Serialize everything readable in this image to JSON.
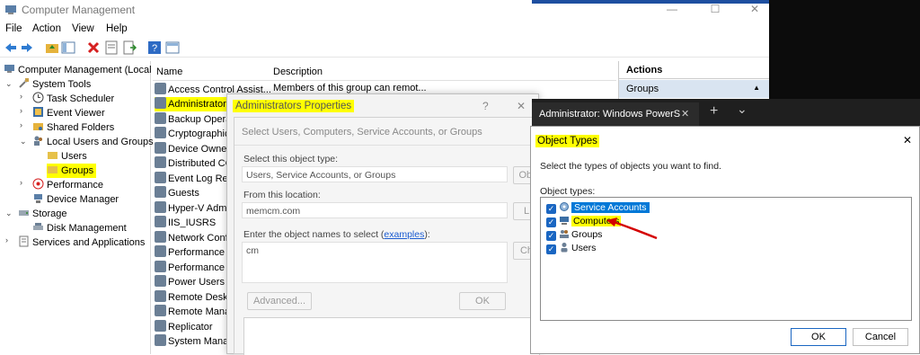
{
  "main_window": {
    "title": "Computer Management",
    "menu": [
      "File",
      "Action",
      "View",
      "Help"
    ],
    "tree": [
      {
        "label": "Computer Management (Local",
        "level": 0
      },
      {
        "label": "System Tools",
        "level": 1
      },
      {
        "label": "Task Scheduler",
        "level": 2
      },
      {
        "label": "Event Viewer",
        "level": 2
      },
      {
        "label": "Shared Folders",
        "level": 2
      },
      {
        "label": "Local Users and Groups",
        "level": 2
      },
      {
        "label": "Users",
        "level": 3
      },
      {
        "label": "Groups",
        "level": 3
      },
      {
        "label": "Performance",
        "level": 2
      },
      {
        "label": "Device Manager",
        "level": 2
      },
      {
        "label": "Storage",
        "level": 1
      },
      {
        "label": "Disk Management",
        "level": 2
      },
      {
        "label": "Services and Applications",
        "level": 1
      }
    ],
    "list_columns": [
      "Name",
      "Description"
    ],
    "list_rows": [
      {
        "name": "Access Control Assist...",
        "desc": "Members of this group can remot..."
      },
      {
        "name": "Administrators",
        "desc": ""
      },
      {
        "name": "Backup Operat",
        "desc": ""
      },
      {
        "name": "Cryptographic",
        "desc": ""
      },
      {
        "name": "Device Owners",
        "desc": ""
      },
      {
        "name": "Distributed CC",
        "desc": ""
      },
      {
        "name": "Event Log Rea",
        "desc": ""
      },
      {
        "name": "Guests",
        "desc": ""
      },
      {
        "name": "Hyper-V Admi",
        "desc": ""
      },
      {
        "name": "IIS_IUSRS",
        "desc": ""
      },
      {
        "name": "Network Confi",
        "desc": ""
      },
      {
        "name": "Performance L",
        "desc": ""
      },
      {
        "name": "Performance M",
        "desc": ""
      },
      {
        "name": "Power Users",
        "desc": ""
      },
      {
        "name": "Remote Deskto",
        "desc": ""
      },
      {
        "name": "Remote Mana",
        "desc": ""
      },
      {
        "name": "Replicator",
        "desc": ""
      },
      {
        "name": "System Manag",
        "desc": ""
      }
    ],
    "actions_title": "Actions",
    "actions_section": "Groups"
  },
  "admin_props": {
    "title": "Administrators Properties",
    "help": "?",
    "close": "✕"
  },
  "select_dialog": {
    "title": "Select Users, Computers, Service Accounts, or Groups",
    "object_type_label": "Select this object type:",
    "object_type_value": "Users, Service Accounts, or Groups",
    "object_types_btn": "Obj",
    "location_label": "From this location:",
    "location_value": "memcm.com",
    "location_btn": "L",
    "names_label_pre": "Enter the object names to select (",
    "names_link": "examples",
    "names_label_post": "):",
    "names_value": "cm",
    "check_btn": "Ch",
    "advanced_btn": "Advanced...",
    "ok_btn": "OK"
  },
  "powershell": {
    "tab_title": "Administrator: Windows PowerS",
    "tab_close": "✕",
    "new_tab": "+",
    "dropdown": "⌄"
  },
  "object_types": {
    "title": "Object Types",
    "close": "✕",
    "description": "Select the types of objects you want to find.",
    "list_label": "Object types:",
    "items": [
      "Service Accounts",
      "Computers",
      "Groups",
      "Users"
    ],
    "ok": "OK",
    "cancel": "Cancel"
  },
  "colors": {
    "highlight": "#ffff00",
    "selection_blue": "#0078d7",
    "checkbox_blue": "#1a66c2",
    "arrow_red": "#d40000"
  }
}
